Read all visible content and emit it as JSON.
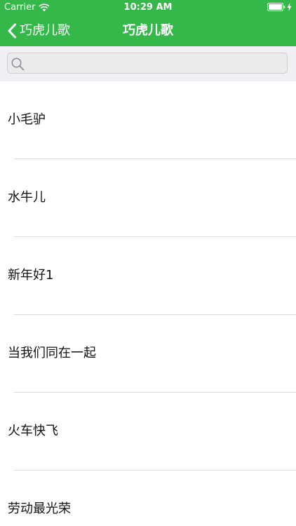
{
  "status_bar": {
    "carrier": "Carrier",
    "time": "10:29 AM",
    "icons": [
      "wifi-icon",
      "battery-icon",
      "charging-bolt-icon"
    ]
  },
  "nav_bar": {
    "back_label": "巧虎儿歌",
    "title": "巧虎儿歌",
    "color": "#35b84a"
  },
  "search": {
    "value": "",
    "placeholder": "",
    "icon": "search-icon"
  },
  "songs": [
    {
      "title": "小毛驴"
    },
    {
      "title": "水牛儿"
    },
    {
      "title": "新年好1"
    },
    {
      "title": "当我们同在一起"
    },
    {
      "title": "火车快飞"
    },
    {
      "title": "劳动最光荣"
    }
  ]
}
